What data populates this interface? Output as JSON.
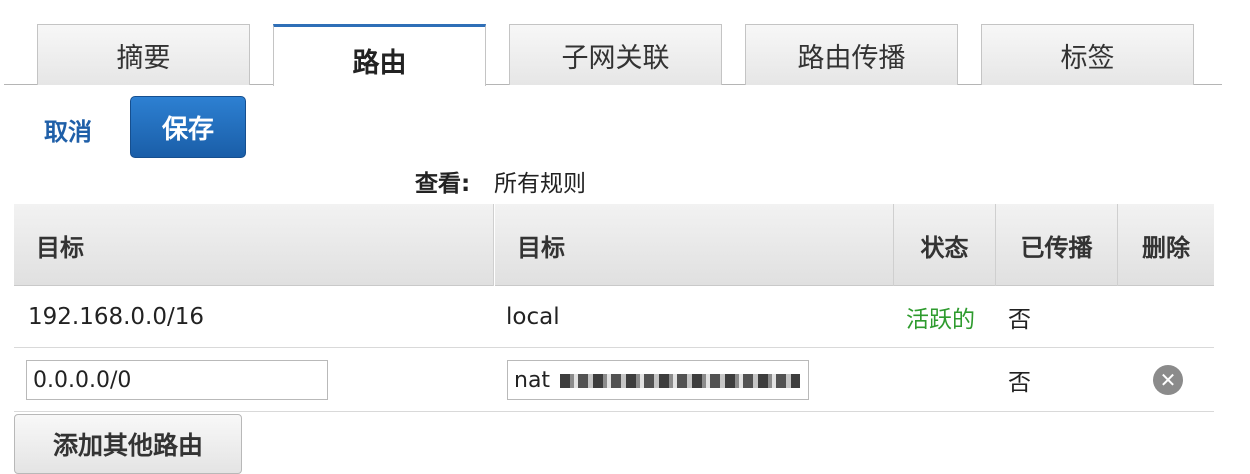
{
  "tabs": [
    {
      "label": "摘要"
    },
    {
      "label": "路由"
    },
    {
      "label": "子网关联"
    },
    {
      "label": "路由传播"
    },
    {
      "label": "标签"
    }
  ],
  "actions": {
    "cancel_label": "取消",
    "save_label": "保存"
  },
  "view": {
    "label": "查看:",
    "value": "所有规则"
  },
  "table": {
    "headers": [
      "目标",
      "目标",
      "状态",
      "已传播",
      "删除"
    ],
    "rows": [
      {
        "destination": "192.168.0.0/16",
        "target": "local",
        "status": "活跃的",
        "propagated": "否"
      },
      {
        "destination": "0.0.0.0/0",
        "target": "nat",
        "status": "",
        "propagated": "否"
      }
    ]
  },
  "add_route_label": "添加其他路由",
  "icons": {
    "delete": "close-circle-icon"
  }
}
